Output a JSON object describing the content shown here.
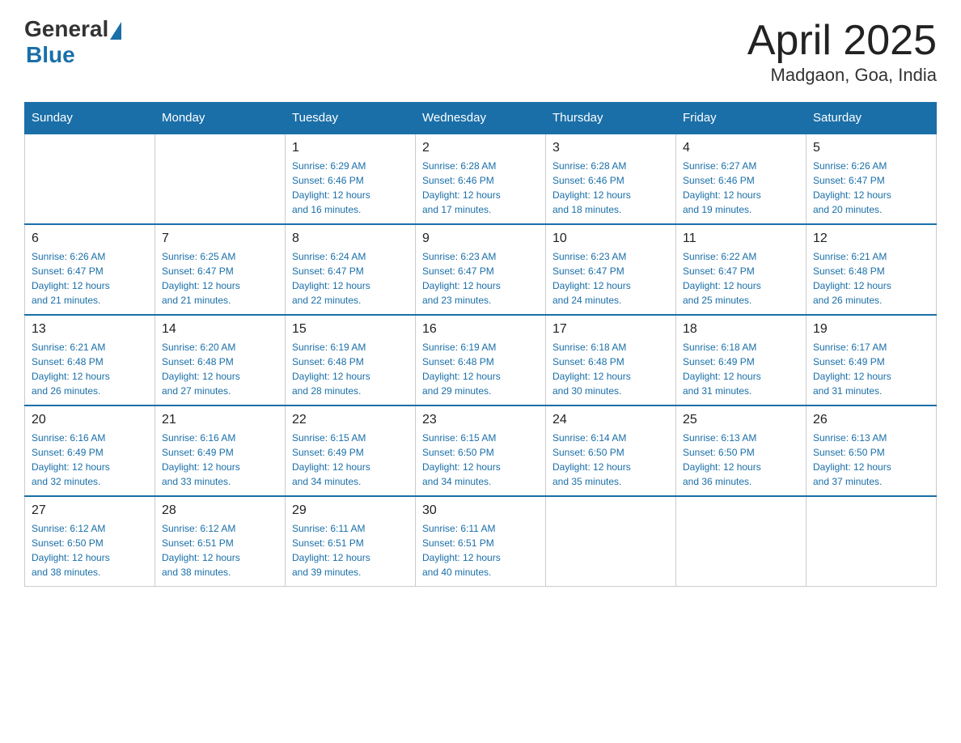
{
  "header": {
    "logo_general": "General",
    "logo_blue": "Blue",
    "month": "April 2025",
    "location": "Madgaon, Goa, India"
  },
  "weekdays": [
    "Sunday",
    "Monday",
    "Tuesday",
    "Wednesday",
    "Thursday",
    "Friday",
    "Saturday"
  ],
  "weeks": [
    [
      {
        "day": "",
        "info": ""
      },
      {
        "day": "",
        "info": ""
      },
      {
        "day": "1",
        "info": "Sunrise: 6:29 AM\nSunset: 6:46 PM\nDaylight: 12 hours\nand 16 minutes."
      },
      {
        "day": "2",
        "info": "Sunrise: 6:28 AM\nSunset: 6:46 PM\nDaylight: 12 hours\nand 17 minutes."
      },
      {
        "day": "3",
        "info": "Sunrise: 6:28 AM\nSunset: 6:46 PM\nDaylight: 12 hours\nand 18 minutes."
      },
      {
        "day": "4",
        "info": "Sunrise: 6:27 AM\nSunset: 6:46 PM\nDaylight: 12 hours\nand 19 minutes."
      },
      {
        "day": "5",
        "info": "Sunrise: 6:26 AM\nSunset: 6:47 PM\nDaylight: 12 hours\nand 20 minutes."
      }
    ],
    [
      {
        "day": "6",
        "info": "Sunrise: 6:26 AM\nSunset: 6:47 PM\nDaylight: 12 hours\nand 21 minutes."
      },
      {
        "day": "7",
        "info": "Sunrise: 6:25 AM\nSunset: 6:47 PM\nDaylight: 12 hours\nand 21 minutes."
      },
      {
        "day": "8",
        "info": "Sunrise: 6:24 AM\nSunset: 6:47 PM\nDaylight: 12 hours\nand 22 minutes."
      },
      {
        "day": "9",
        "info": "Sunrise: 6:23 AM\nSunset: 6:47 PM\nDaylight: 12 hours\nand 23 minutes."
      },
      {
        "day": "10",
        "info": "Sunrise: 6:23 AM\nSunset: 6:47 PM\nDaylight: 12 hours\nand 24 minutes."
      },
      {
        "day": "11",
        "info": "Sunrise: 6:22 AM\nSunset: 6:47 PM\nDaylight: 12 hours\nand 25 minutes."
      },
      {
        "day": "12",
        "info": "Sunrise: 6:21 AM\nSunset: 6:48 PM\nDaylight: 12 hours\nand 26 minutes."
      }
    ],
    [
      {
        "day": "13",
        "info": "Sunrise: 6:21 AM\nSunset: 6:48 PM\nDaylight: 12 hours\nand 26 minutes."
      },
      {
        "day": "14",
        "info": "Sunrise: 6:20 AM\nSunset: 6:48 PM\nDaylight: 12 hours\nand 27 minutes."
      },
      {
        "day": "15",
        "info": "Sunrise: 6:19 AM\nSunset: 6:48 PM\nDaylight: 12 hours\nand 28 minutes."
      },
      {
        "day": "16",
        "info": "Sunrise: 6:19 AM\nSunset: 6:48 PM\nDaylight: 12 hours\nand 29 minutes."
      },
      {
        "day": "17",
        "info": "Sunrise: 6:18 AM\nSunset: 6:48 PM\nDaylight: 12 hours\nand 30 minutes."
      },
      {
        "day": "18",
        "info": "Sunrise: 6:18 AM\nSunset: 6:49 PM\nDaylight: 12 hours\nand 31 minutes."
      },
      {
        "day": "19",
        "info": "Sunrise: 6:17 AM\nSunset: 6:49 PM\nDaylight: 12 hours\nand 31 minutes."
      }
    ],
    [
      {
        "day": "20",
        "info": "Sunrise: 6:16 AM\nSunset: 6:49 PM\nDaylight: 12 hours\nand 32 minutes."
      },
      {
        "day": "21",
        "info": "Sunrise: 6:16 AM\nSunset: 6:49 PM\nDaylight: 12 hours\nand 33 minutes."
      },
      {
        "day": "22",
        "info": "Sunrise: 6:15 AM\nSunset: 6:49 PM\nDaylight: 12 hours\nand 34 minutes."
      },
      {
        "day": "23",
        "info": "Sunrise: 6:15 AM\nSunset: 6:50 PM\nDaylight: 12 hours\nand 34 minutes."
      },
      {
        "day": "24",
        "info": "Sunrise: 6:14 AM\nSunset: 6:50 PM\nDaylight: 12 hours\nand 35 minutes."
      },
      {
        "day": "25",
        "info": "Sunrise: 6:13 AM\nSunset: 6:50 PM\nDaylight: 12 hours\nand 36 minutes."
      },
      {
        "day": "26",
        "info": "Sunrise: 6:13 AM\nSunset: 6:50 PM\nDaylight: 12 hours\nand 37 minutes."
      }
    ],
    [
      {
        "day": "27",
        "info": "Sunrise: 6:12 AM\nSunset: 6:50 PM\nDaylight: 12 hours\nand 38 minutes."
      },
      {
        "day": "28",
        "info": "Sunrise: 6:12 AM\nSunset: 6:51 PM\nDaylight: 12 hours\nand 38 minutes."
      },
      {
        "day": "29",
        "info": "Sunrise: 6:11 AM\nSunset: 6:51 PM\nDaylight: 12 hours\nand 39 minutes."
      },
      {
        "day": "30",
        "info": "Sunrise: 6:11 AM\nSunset: 6:51 PM\nDaylight: 12 hours\nand 40 minutes."
      },
      {
        "day": "",
        "info": ""
      },
      {
        "day": "",
        "info": ""
      },
      {
        "day": "",
        "info": ""
      }
    ]
  ]
}
